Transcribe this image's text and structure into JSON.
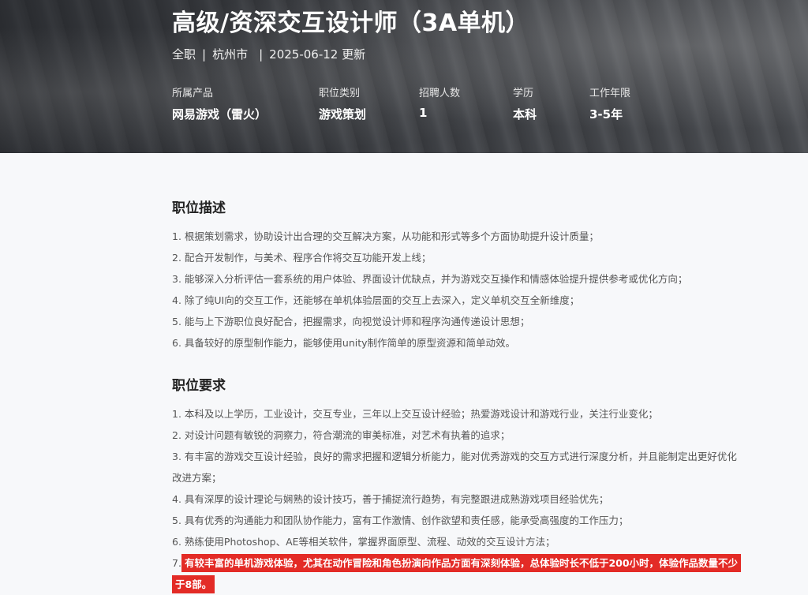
{
  "header": {
    "title": "高级/资深交互设计师（3A单机）",
    "employment_type": "全职",
    "location": "杭州市",
    "date": "2025-06-12 更新",
    "separator": "|",
    "info": [
      {
        "label": "所属产品",
        "value": "网易游戏（雷火）"
      },
      {
        "label": "职位类别",
        "value": "游戏策划"
      },
      {
        "label": "招聘人数",
        "value": "1"
      },
      {
        "label": "学历",
        "value": "本科"
      },
      {
        "label": "工作年限",
        "value": "3-5年"
      }
    ]
  },
  "description": {
    "title": "职位描述",
    "items": [
      "1. 根据策划需求，协助设计出合理的交互解决方案，从功能和形式等多个方面协助提升设计质量；",
      "2. 配合开发制作，与美术、程序合作将交互功能开发上线；",
      "3. 能够深入分析评估一套系统的用户体验、界面设计优缺点，并为游戏交互操作和情感体验提升提供参考或优化方向；",
      "4. 除了纯UI向的交互工作，还能够在单机体验层面的交互上去深入，定义单机交互全新维度；",
      "5. 能与上下游职位良好配合，把握需求，向视觉设计师和程序沟通传递设计思想；",
      "6. 具备较好的原型制作能力，能够使用unity制作简单的原型资源和简单动效。"
    ]
  },
  "requirements": {
    "title": "职位要求",
    "items": [
      "1. 本科及以上学历，工业设计，交互专业，三年以上交互设计经验；热爱游戏设计和游戏行业，关注行业变化；",
      "2. 对设计问题有敏锐的洞察力，符合潮流的审美标准，对艺术有执着的追求；",
      "3. 有丰富的游戏交互设计经验，良好的需求把握和逻辑分析能力，能对优秀游戏的交互方式进行深度分析，并且能制定出更好优化改进方案；",
      "4. 具有深厚的设计理论与娴熟的设计技巧，善于捕捉流行趋势，有完整跟进成熟游戏项目经验优先；",
      "5. 具有优秀的沟通能力和团队协作能力，富有工作激情、创作欲望和责任感，能承受高强度的工作压力；",
      "6. 熟练使用Photoshop、AE等相关软件，掌握界面原型、流程、动效的交互设计方法；"
    ],
    "item7_prefix": "7.",
    "item7_highlight": "有较丰富的单机游戏体验，尤其在动作冒险和角色扮演向作品方面有深刻体验，总体验时长不低于200小时，体验作品数量不少于8部。"
  },
  "colors": {
    "highlight": "#e32b26",
    "title_text": "#222222",
    "body_text": "#555555"
  }
}
